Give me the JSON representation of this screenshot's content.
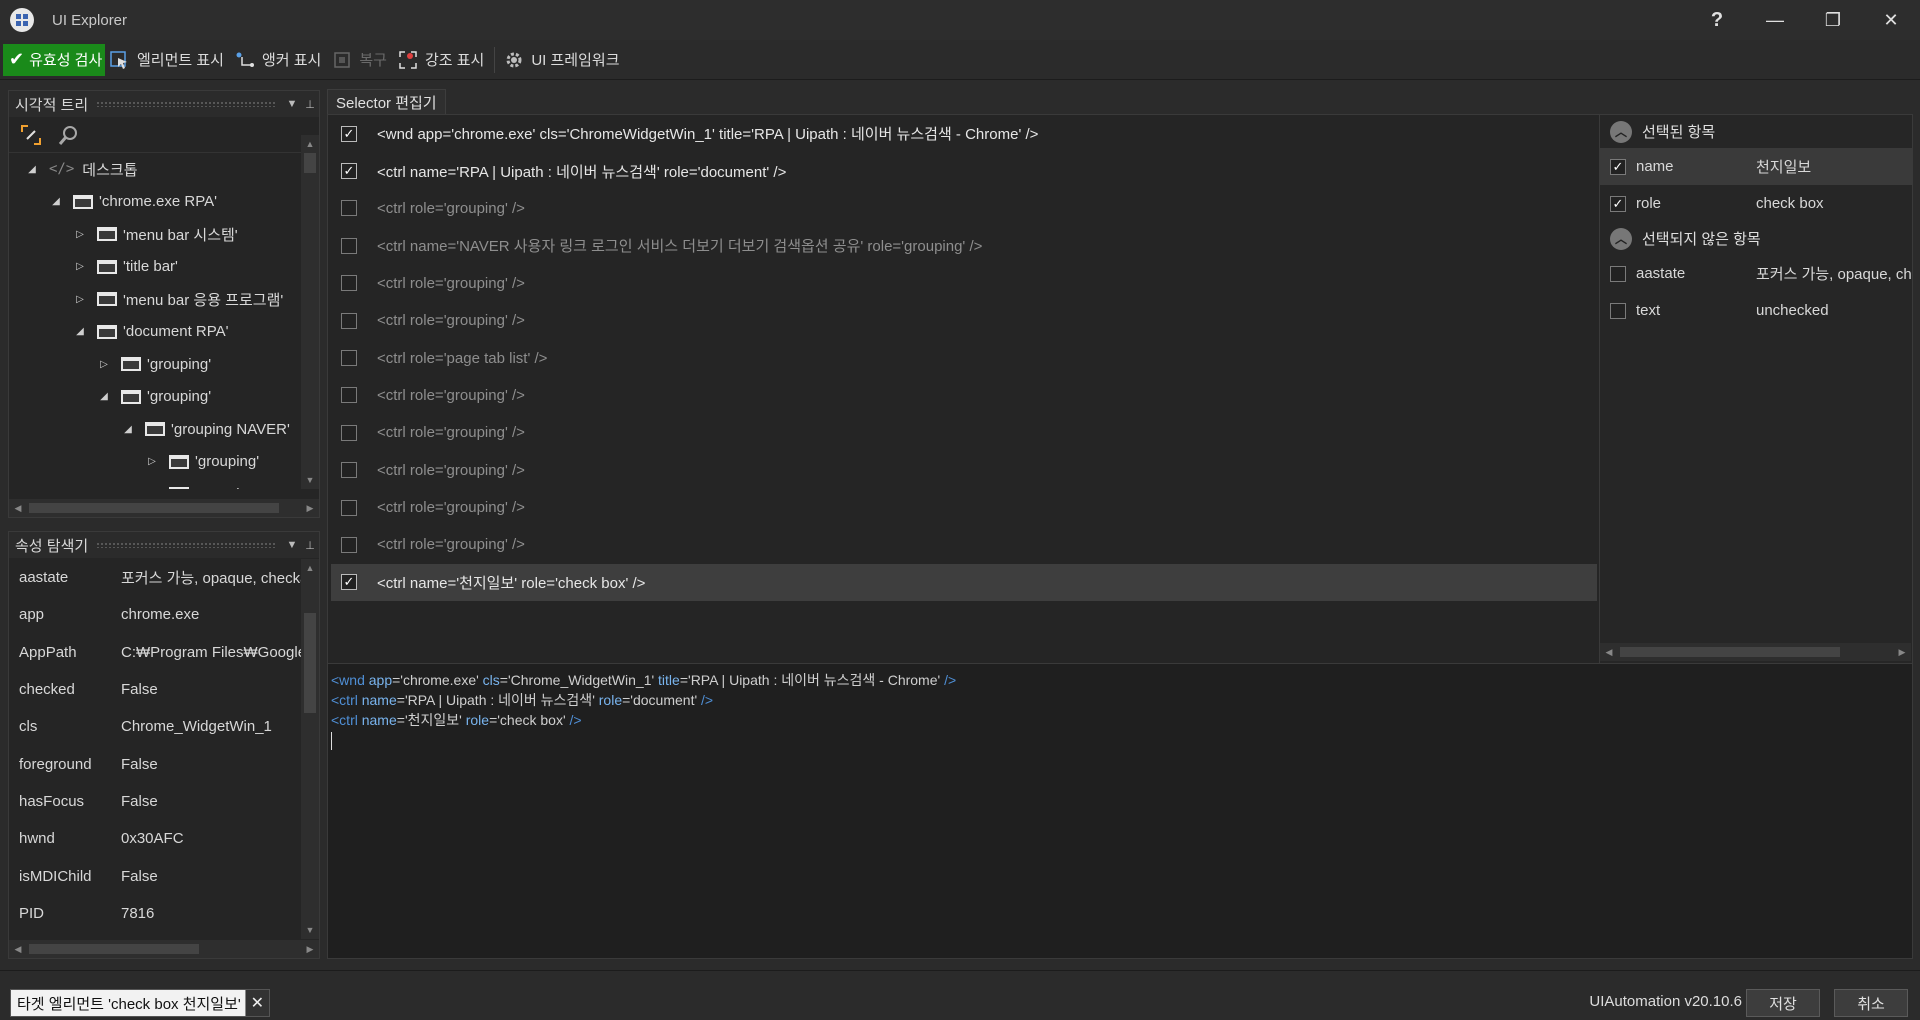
{
  "window": {
    "title": "UI Explorer",
    "help": "?",
    "minimize": "—",
    "restore": "❐",
    "close": "✕"
  },
  "toolbar": {
    "validate": "유효성 검사",
    "show_element": "엘리먼트 표시",
    "show_anchor": "앵커 표시",
    "restore": "복구",
    "highlight": "강조 표시",
    "ui_framework": "UI 프레임워크"
  },
  "visual_tree": {
    "title": "시각적 트리",
    "items": [
      {
        "label": "데스크톱",
        "indent": 0,
        "arrow": "◢",
        "icon": "code"
      },
      {
        "label": "'chrome.exe RPA'",
        "indent": 1,
        "arrow": "◢",
        "icon": "window"
      },
      {
        "label": "'menu bar  시스템'",
        "indent": 2,
        "arrow": "▷",
        "icon": "window"
      },
      {
        "label": "'title bar'",
        "indent": 2,
        "arrow": "▷",
        "icon": "window"
      },
      {
        "label": "'menu bar  응용 프로그램'",
        "indent": 2,
        "arrow": "▷",
        "icon": "window"
      },
      {
        "label": "'document RPA'",
        "indent": 2,
        "arrow": "◢",
        "icon": "window"
      },
      {
        "label": "'grouping'",
        "indent": 3,
        "arrow": "▷",
        "icon": "window"
      },
      {
        "label": "'grouping'",
        "indent": 3,
        "arrow": "◢",
        "icon": "window"
      },
      {
        "label": "'grouping NAVER'",
        "indent": 4,
        "arrow": "◢",
        "icon": "window"
      },
      {
        "label": "'grouping'",
        "indent": 5,
        "arrow": "▷",
        "icon": "window"
      },
      {
        "label": "'grouping'",
        "indent": 5,
        "arrow": "◢",
        "icon": "window"
      }
    ]
  },
  "property_explorer": {
    "title": "속성 탐색기",
    "rows": [
      {
        "key": "aastate",
        "value": "포커스 가능, opaque, checkable"
      },
      {
        "key": "app",
        "value": "chrome.exe"
      },
      {
        "key": "AppPath",
        "value": "C:₩Program Files₩Google₩Chrome"
      },
      {
        "key": "checked",
        "value": "False"
      },
      {
        "key": "cls",
        "value": "Chrome_WidgetWin_1"
      },
      {
        "key": "foreground",
        "value": "False"
      },
      {
        "key": "hasFocus",
        "value": "False"
      },
      {
        "key": "hwnd",
        "value": "0x30AFC"
      },
      {
        "key": "isMDIChild",
        "value": "False"
      },
      {
        "key": "PID",
        "value": "7816"
      }
    ]
  },
  "selector_editor": {
    "tab": "Selector 편집기",
    "rows": [
      {
        "text": "<wnd app='chrome.exe' cls='ChromeWidgetWin_1' title='RPA | Uipath : 네이버 뉴스검색 - Chrome' />",
        "checked": true,
        "selected": false
      },
      {
        "text": "<ctrl name='RPA | Uipath : 네이버 뉴스검색' role='document' />",
        "checked": true,
        "selected": false
      },
      {
        "text": "<ctrl role='grouping' />",
        "checked": false,
        "selected": false
      },
      {
        "text": "<ctrl name='NAVER 사용자 링크 로그인 서비스 더보기 더보기 검색옵션 공유' role='grouping' />",
        "checked": false,
        "selected": false
      },
      {
        "text": "<ctrl role='grouping' />",
        "checked": false,
        "selected": false
      },
      {
        "text": "<ctrl role='grouping' />",
        "checked": false,
        "selected": false
      },
      {
        "text": "<ctrl role='page tab list' />",
        "checked": false,
        "selected": false
      },
      {
        "text": "<ctrl role='grouping' />",
        "checked": false,
        "selected": false
      },
      {
        "text": "<ctrl role='grouping' />",
        "checked": false,
        "selected": false
      },
      {
        "text": "<ctrl role='grouping' />",
        "checked": false,
        "selected": false
      },
      {
        "text": "<ctrl role='grouping' />",
        "checked": false,
        "selected": false
      },
      {
        "text": "<ctrl role='grouping' />",
        "checked": false,
        "selected": false
      },
      {
        "text": "<ctrl name='천지일보' role='check box' />",
        "checked": true,
        "selected": true
      }
    ]
  },
  "attributes": {
    "selected_title": "선택된 항목",
    "selected": [
      {
        "key": "name",
        "value": "천지일보",
        "checked": true,
        "highlight": true
      },
      {
        "key": "role",
        "value": "check box",
        "checked": true,
        "highlight": false
      }
    ],
    "unselected_title": "선택되지 않은 항목",
    "unselected": [
      {
        "key": "aastate",
        "value": "포커스 가능, opaque, checkable",
        "checked": false,
        "highlight": false
      },
      {
        "key": "text",
        "value": "unchecked",
        "checked": false,
        "highlight": false
      }
    ]
  },
  "code": {
    "lines": [
      [
        [
          "tag",
          "<wnd "
        ],
        [
          "attr",
          "app"
        ],
        [
          "val",
          "='chrome.exe' "
        ],
        [
          "attr",
          "cls"
        ],
        [
          "val",
          "='Chrome_WidgetWin_1' "
        ],
        [
          "attr",
          "title"
        ],
        [
          "val",
          "='RPA | Uipath : 네이버 뉴스검색 - Chrome' "
        ],
        [
          "tag",
          "/>"
        ]
      ],
      [
        [
          "tag",
          "<ctrl "
        ],
        [
          "attr",
          "name"
        ],
        [
          "val",
          "='RPA | Uipath : 네이버 뉴스검색' "
        ],
        [
          "attr",
          "role"
        ],
        [
          "val",
          "='document' "
        ],
        [
          "tag",
          "/>"
        ]
      ],
      [
        [
          "tag",
          "<ctrl "
        ],
        [
          "attr",
          "name"
        ],
        [
          "val",
          "='천지일보' "
        ],
        [
          "attr",
          "role"
        ],
        [
          "val",
          "='check box' "
        ],
        [
          "tag",
          "/>"
        ]
      ]
    ]
  },
  "status": {
    "target": "타겟 엘리먼트 'check box  천지일보'",
    "framework": "UIAutomation v20.10.6",
    "save": "저장",
    "cancel": "취소"
  }
}
